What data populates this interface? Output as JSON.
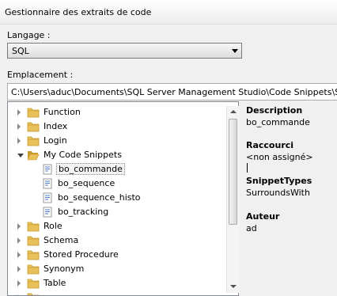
{
  "window": {
    "title": "Gestionnaire des extraits de code"
  },
  "language": {
    "label": "Langage :",
    "selected": "SQL"
  },
  "location": {
    "label": "Emplacement :",
    "path": "C:\\Users\\aduc\\Documents\\SQL Server Management Studio\\Code Snippets\\SQ"
  },
  "tree": {
    "items": [
      {
        "label": "Function",
        "type": "folder",
        "expander": "closed",
        "level": 0
      },
      {
        "label": "Index",
        "type": "folder",
        "expander": "closed",
        "level": 0
      },
      {
        "label": "Login",
        "type": "folder",
        "expander": "closed",
        "level": 0
      },
      {
        "label": "My Code Snippets",
        "type": "folder-open",
        "expander": "open",
        "level": 0
      },
      {
        "label": "bo_commande",
        "type": "snippet",
        "expander": "none",
        "level": 1,
        "selected": true
      },
      {
        "label": "bo_sequence",
        "type": "snippet",
        "expander": "none",
        "level": 1
      },
      {
        "label": "bo_sequence_histo",
        "type": "snippet",
        "expander": "none",
        "level": 1
      },
      {
        "label": "bo_tracking",
        "type": "snippet",
        "expander": "none",
        "level": 1
      },
      {
        "label": "Role",
        "type": "folder",
        "expander": "closed",
        "level": 0
      },
      {
        "label": "Schema",
        "type": "folder",
        "expander": "closed",
        "level": 0
      },
      {
        "label": "Stored Procedure",
        "type": "folder",
        "expander": "closed",
        "level": 0
      },
      {
        "label": "Synonym",
        "type": "folder",
        "expander": "closed",
        "level": 0
      },
      {
        "label": "Table",
        "type": "folder",
        "expander": "closed",
        "level": 0
      },
      {
        "label": "",
        "type": "folder",
        "expander": "closed",
        "level": 0
      }
    ]
  },
  "properties": {
    "description": {
      "heading": "Description",
      "value": "bo_commande"
    },
    "shortcut": {
      "heading": "Raccourci",
      "value": "<non assigné>"
    },
    "types": {
      "heading": "SnippetTypes",
      "value": "SurroundsWith"
    },
    "author": {
      "heading": "Auteur",
      "value": "ad"
    }
  },
  "colors": {
    "folder": "#e8c15a",
    "folder_dark": "#c8982a",
    "snippet_icon": "#4a7cc7"
  }
}
